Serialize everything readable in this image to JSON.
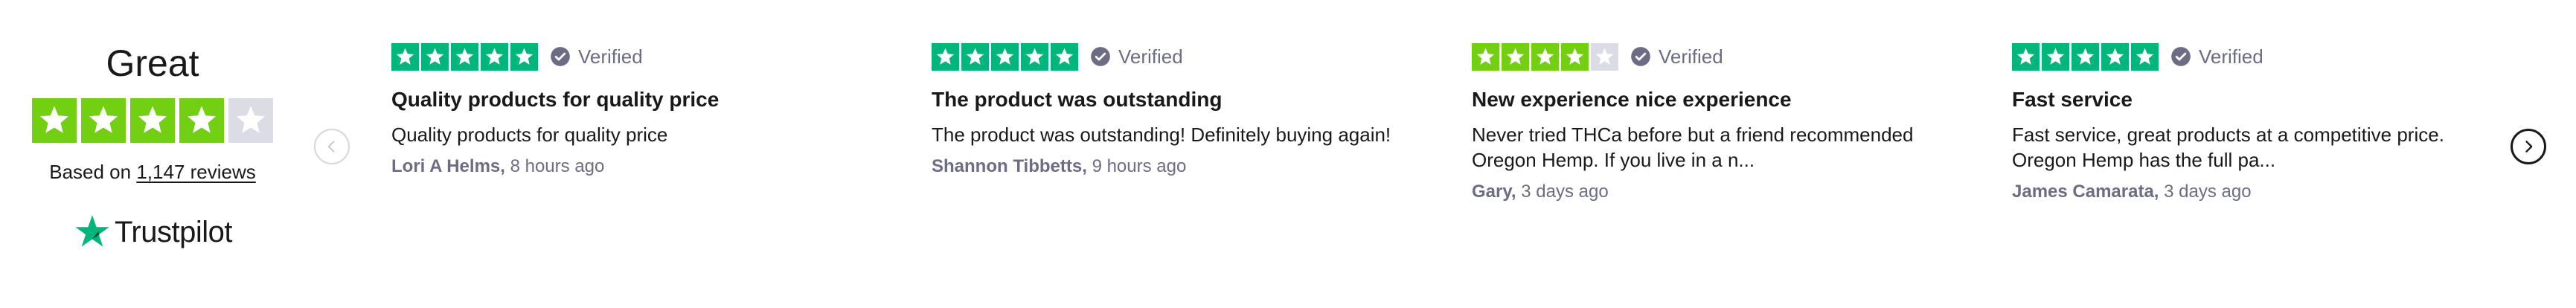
{
  "summary": {
    "rating_word": "Great",
    "stars_filled": 4,
    "stars_total": 5,
    "based_on_prefix": "Based on",
    "review_count_link": "1,147 reviews",
    "logo_text": "Trustpilot"
  },
  "colors": {
    "trustpilot_green": "#00b67a",
    "four_star_green": "#73cf11",
    "empty_star": "#dcdce6",
    "verified_grey": "#6c6c85",
    "text": "#191919"
  },
  "verified_label": "Verified",
  "nav": {
    "prev_icon": "chevron-left-icon",
    "next_icon": "chevron-right-icon"
  },
  "reviews": [
    {
      "stars": 5,
      "title": "Quality products for quality price",
      "body": "Quality products for quality price",
      "author": "Lori A Helms,",
      "time": "8 hours ago"
    },
    {
      "stars": 5,
      "title": "The product was outstanding",
      "body": "The product was outstanding! Definitely buying again!",
      "author": "Shannon Tibbetts,",
      "time": "9 hours ago"
    },
    {
      "stars": 4,
      "title": "New experience nice experience",
      "body": "Never tried THCa before but a friend recommended Oregon Hemp. If you live in a n...",
      "author": "Gary,",
      "time": "3 days ago"
    },
    {
      "stars": 5,
      "title": "Fast service",
      "body": "Fast service, great products at a competitive price. Oregon Hemp has the full pa...",
      "author": "James Camarata,",
      "time": "3 days ago"
    }
  ]
}
